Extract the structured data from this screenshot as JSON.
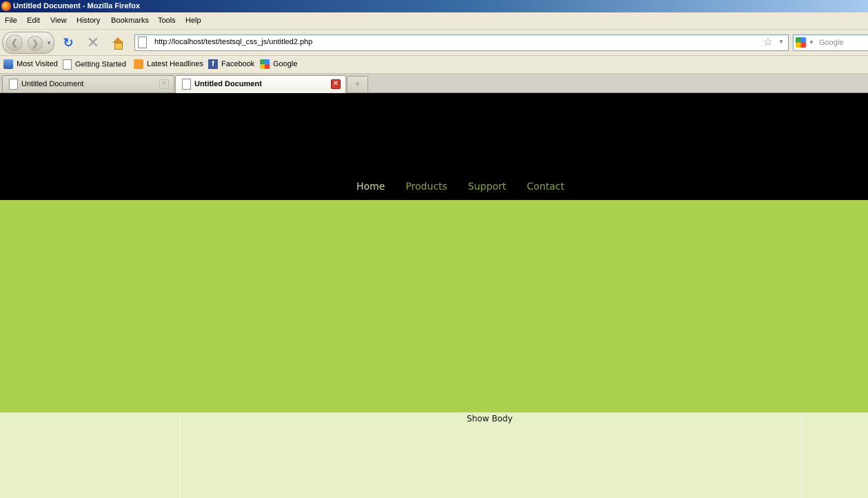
{
  "window": {
    "title": "Untitled Document - Mozilla Firefox"
  },
  "menu": [
    "File",
    "Edit",
    "View",
    "History",
    "Bookmarks",
    "Tools",
    "Help"
  ],
  "navbar": {
    "url": "http://localhost/test/testsql_css_js/untitled2.php",
    "search_placeholder": "Google"
  },
  "bookmarks": [
    "Most Visited",
    "Getting Started",
    "Latest Headlines",
    "Facebook",
    "Google"
  ],
  "tabs": [
    {
      "label": "Untitled Document",
      "active": false
    },
    {
      "label": "Untitled Document",
      "active": true
    }
  ],
  "site": {
    "nav": [
      {
        "label": "Home",
        "active": true
      },
      {
        "label": "Products",
        "active": false
      },
      {
        "label": "Support",
        "active": false
      },
      {
        "label": "Contact",
        "active": false
      }
    ],
    "body_text": "Show Body"
  },
  "colors": {
    "header": "#000000",
    "nav_link": "#8fa54a",
    "nav_active": "#cfdc9a",
    "banner": "#a9d14b",
    "body_bg": "#e7f0c6"
  }
}
